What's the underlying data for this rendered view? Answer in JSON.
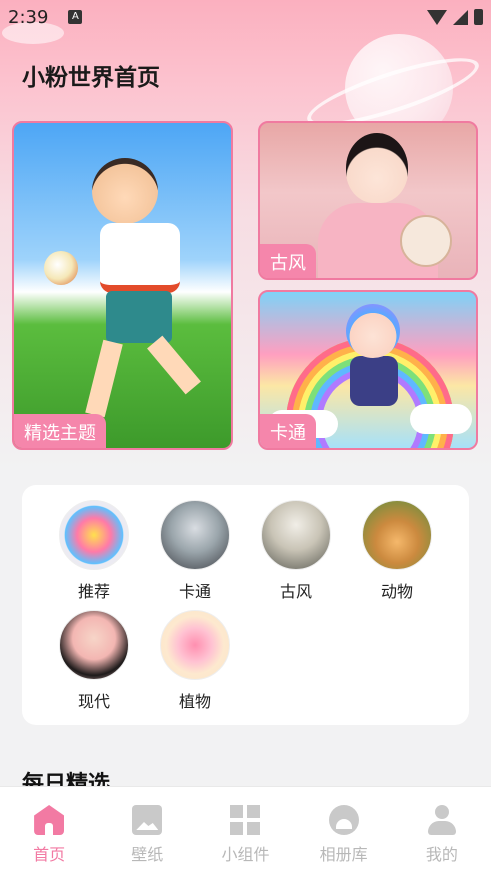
{
  "status_bar": {
    "time": "2:39",
    "notification_icon": "a-icon",
    "icons": [
      "wifi-icon",
      "signal-icon",
      "battery-icon"
    ]
  },
  "header": {
    "title": "小粉世界首页"
  },
  "feature_cards": {
    "main": {
      "label": "精选主题",
      "image": "boy-playing-soccer"
    },
    "gufeng": {
      "label": "古风",
      "image": "ancient-style-lady"
    },
    "katong": {
      "label": "卡通",
      "image": "cartoon-rainbow-girl"
    }
  },
  "categories": [
    {
      "label": "推荐"
    },
    {
      "label": "卡通"
    },
    {
      "label": "古风"
    },
    {
      "label": "动物"
    },
    {
      "label": "现代"
    },
    {
      "label": "植物"
    }
  ],
  "sections": {
    "daily_title": "每日精选"
  },
  "bottom_nav": {
    "items": [
      {
        "label": "首页",
        "icon": "home-icon",
        "active": true
      },
      {
        "label": "壁纸",
        "icon": "wallpaper-icon",
        "active": false
      },
      {
        "label": "小组件",
        "icon": "widgets-icon",
        "active": false
      },
      {
        "label": "相册库",
        "icon": "album-icon",
        "active": false
      },
      {
        "label": "我的",
        "icon": "profile-icon",
        "active": false
      }
    ]
  },
  "colors": {
    "accent": "#f27aa3",
    "label_bg": "#f586ab",
    "header_gradient_top": "#fbb0bf",
    "page_bg": "#f2f2f3"
  }
}
